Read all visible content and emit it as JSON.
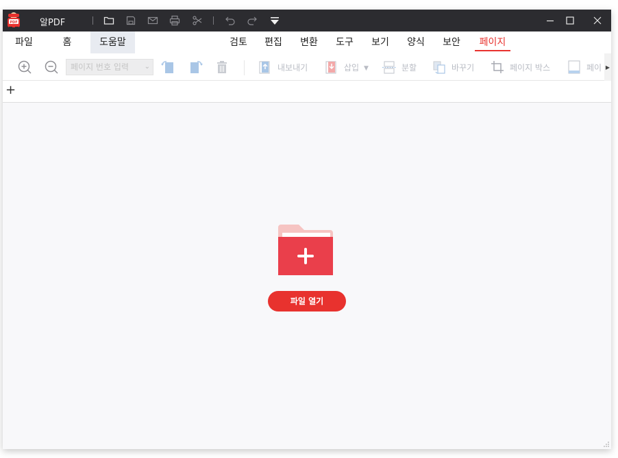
{
  "app": {
    "title": "알PDF",
    "logo_text": "PDF"
  },
  "titlebar": {
    "quick_actions": [
      "folder-open",
      "save",
      "mail",
      "print",
      "scissors",
      "undo",
      "redo",
      "customize"
    ]
  },
  "menu": {
    "left": [
      "파일",
      "홈",
      "도움말"
    ],
    "right": [
      "검토",
      "편집",
      "변환",
      "도구",
      "보기",
      "양식",
      "보안",
      "페이지"
    ],
    "selected": "페이지"
  },
  "toolbar": {
    "page_number_placeholder": "페이지 번호 입력",
    "export_label": "내보내기",
    "insert_label": "삽입",
    "split_label": "분할",
    "replace_label": "바꾸기",
    "page_box_label": "페이지 박스",
    "overflow_label": "페이"
  },
  "tabs": {
    "new_tab_symbol": "+"
  },
  "main": {
    "open_file_label": "파일 열기"
  },
  "colors": {
    "accent": "#e8322e",
    "titlebar_bg": "#2c2c30",
    "folder_back": "#f6c4c2",
    "folder_front": "#ea3f4b"
  }
}
